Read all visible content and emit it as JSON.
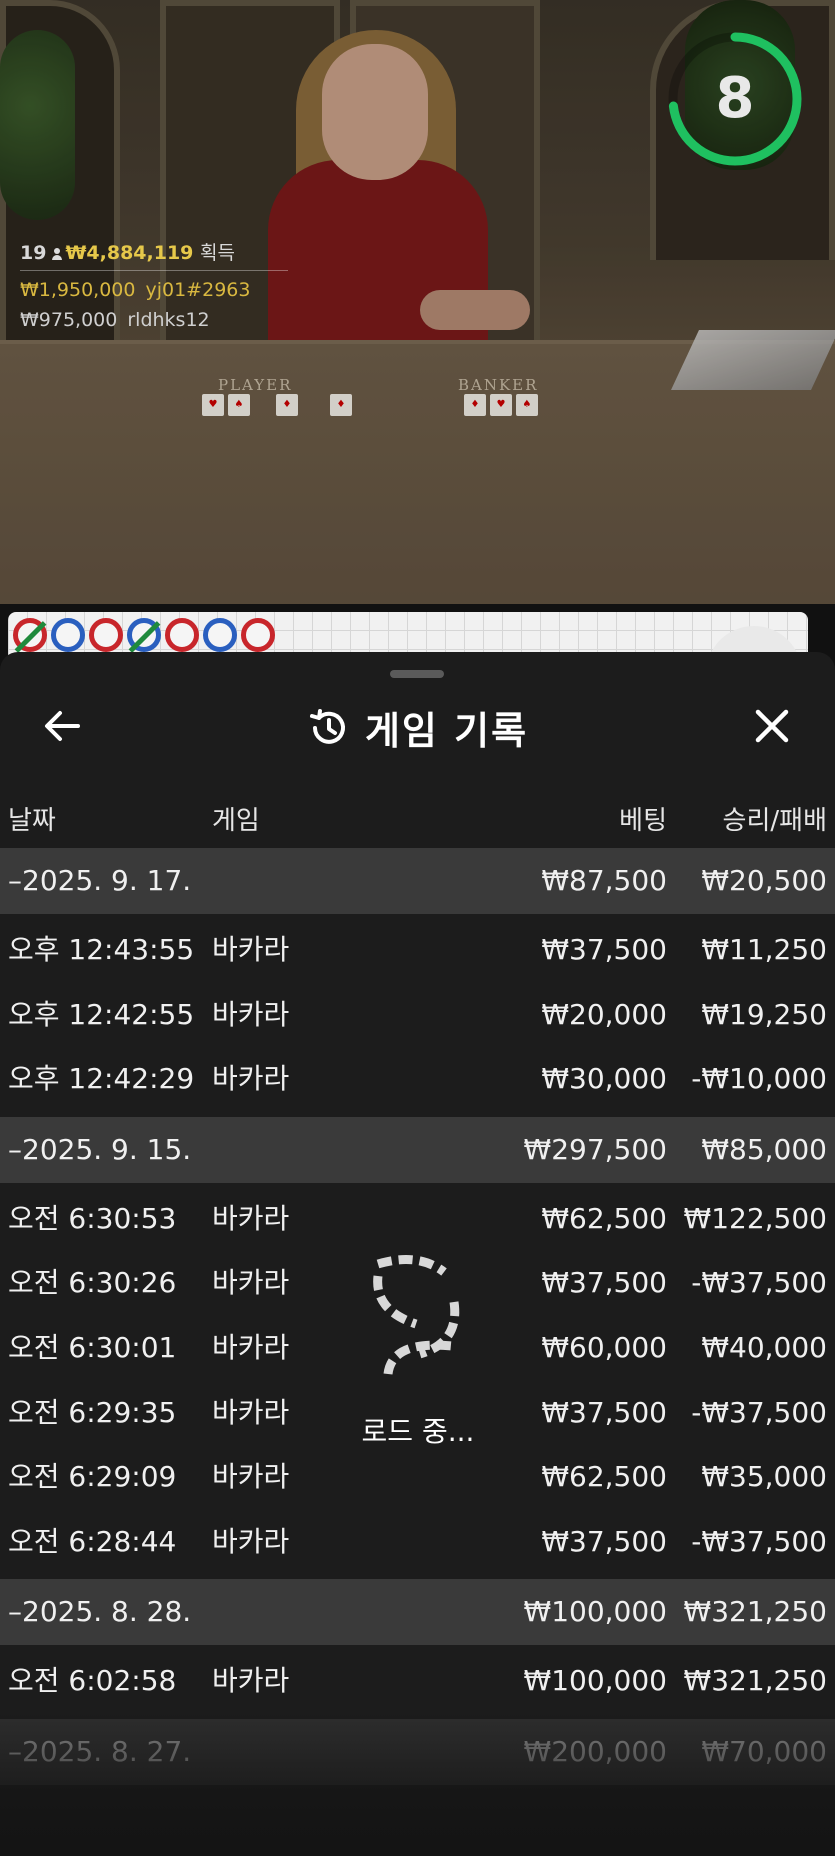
{
  "video": {
    "table_labels": {
      "player": "PLAYER",
      "banker": "BANKER"
    },
    "countdown": "8",
    "countdown_color": "#1fc060",
    "winners": {
      "count": "19",
      "total": "₩4,884,119",
      "total_label": "획득",
      "entries": [
        {
          "amount": "₩1,950,000",
          "name": "yj01#2963"
        },
        {
          "amount": "₩975,000",
          "name": "rldhks12"
        }
      ]
    }
  },
  "roadmap": {
    "beads": [
      {
        "side": "banker",
        "tie": true
      },
      {
        "side": "player",
        "tie": false
      },
      {
        "side": "banker",
        "tie": false
      },
      {
        "side": "player",
        "tie": true
      },
      {
        "side": "banker",
        "tie": false
      },
      {
        "side": "player",
        "tie": false
      },
      {
        "side": "banker",
        "tie": false
      }
    ],
    "colors": {
      "player": "#2a5fbf",
      "banker": "#c8262b",
      "tie": "#1f8a3c"
    }
  },
  "panel": {
    "title": "게임 기록",
    "back_icon": "arrow-left-icon",
    "history_icon": "history-clock-icon",
    "close_icon": "close-icon",
    "columns": {
      "date": "날짜",
      "game": "게임",
      "bet": "베팅",
      "win": "승리/패배"
    },
    "loading_text": "로드 중...",
    "groups": [
      {
        "date": "–2025. 9. 17.",
        "bet": "₩87,500",
        "win": "₩20,500",
        "rows": [
          {
            "time": "오후 12:43:55",
            "game": "바카라",
            "bet": "₩37,500",
            "win": "₩11,250"
          },
          {
            "time": "오후 12:42:55",
            "game": "바카라",
            "bet": "₩20,000",
            "win": "₩19,250"
          },
          {
            "time": "오후 12:42:29",
            "game": "바카라",
            "bet": "₩30,000",
            "win": "-₩10,000"
          }
        ]
      },
      {
        "date": "–2025. 9. 15.",
        "bet": "₩297,500",
        "win": "₩85,000",
        "rows": [
          {
            "time": "오전 6:30:53",
            "game": "바카라",
            "bet": "₩62,500",
            "win": "₩122,500"
          },
          {
            "time": "오전 6:30:26",
            "game": "바카라",
            "bet": "₩37,500",
            "win": "-₩37,500"
          },
          {
            "time": "오전 6:30:01",
            "game": "바카라",
            "bet": "₩60,000",
            "win": "₩40,000"
          },
          {
            "time": "오전 6:29:35",
            "game": "바카라",
            "bet": "₩37,500",
            "win": "-₩37,500"
          },
          {
            "time": "오전 6:29:09",
            "game": "바카라",
            "bet": "₩62,500",
            "win": "₩35,000"
          },
          {
            "time": "오전 6:28:44",
            "game": "바카라",
            "bet": "₩37,500",
            "win": "-₩37,500"
          }
        ]
      },
      {
        "date": "–2025. 8. 28.",
        "bet": "₩100,000",
        "win": "₩321,250",
        "rows": [
          {
            "time": "오전 6:02:58",
            "game": "바카라",
            "bet": "₩100,000",
            "win": "₩321,250"
          }
        ]
      },
      {
        "date": "–2025. 8. 27.",
        "bet": "₩200,000",
        "win": "₩70,000",
        "rows": []
      }
    ]
  }
}
